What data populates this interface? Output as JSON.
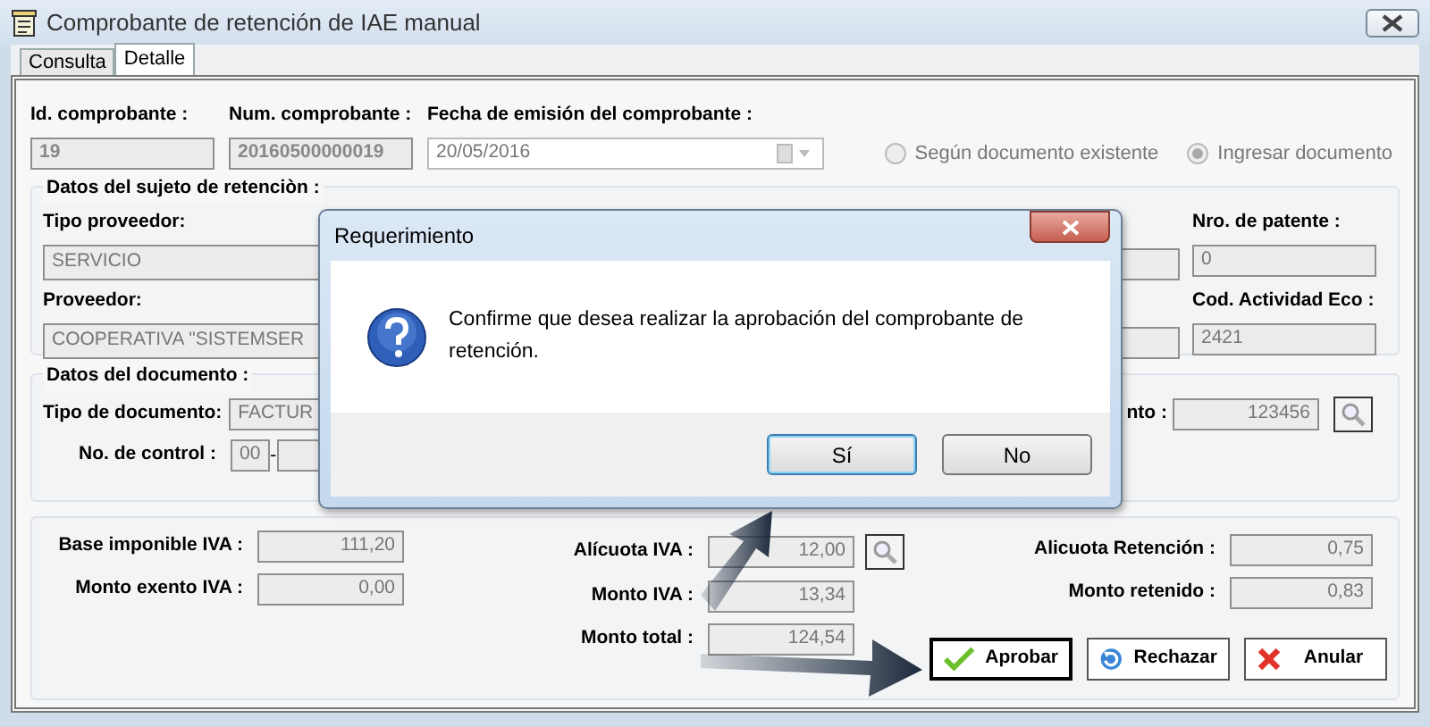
{
  "window": {
    "title": "Comprobante de retención de IAE manual"
  },
  "tabs": [
    {
      "label": "Consulta",
      "selected": false
    },
    {
      "label": "Detalle",
      "selected": true
    }
  ],
  "header_fields": [
    {
      "label": "Id. comprobante :",
      "value": "19"
    },
    {
      "label": "Num. comprobante :",
      "value": "20160500000019"
    },
    {
      "label": "Fecha de emisión del comprobante :",
      "value": "20/05/2016"
    }
  ],
  "source_options": [
    {
      "label": "Según documento existente",
      "selected": false
    },
    {
      "label": "Ingresar documento",
      "selected": true
    }
  ],
  "subject_group": {
    "title": "Datos del sujeto de retenciòn :",
    "left_fields": [
      {
        "label": "Tipo proveedor:",
        "value": "SERVICIO"
      },
      {
        "label": "Proveedor:",
        "value": "COOPERATIVA \"SISTEMSER"
      }
    ],
    "right_fields": [
      {
        "label": "Nro. de patente :",
        "value": "0"
      },
      {
        "label": "Cod. Actividad Eco :",
        "value": "2421"
      }
    ]
  },
  "document_group": {
    "title": "Datos del documento :",
    "type_field": {
      "label": "Tipo de documento:",
      "value": "FACTUR"
    },
    "control_field": {
      "label": "No. de control :",
      "prefix": "00",
      "separator": "-"
    },
    "number_field": {
      "label": "nto :",
      "value": "123456"
    }
  },
  "amounts": {
    "left": [
      {
        "label": "Base imponible IVA :",
        "value": "111,20"
      },
      {
        "label": "Monto exento IVA :",
        "value": "0,00"
      }
    ],
    "middle": [
      {
        "label": "Alícuota IVA :",
        "value": "12,00",
        "lookup": true
      },
      {
        "label": "Monto IVA :",
        "value": "13,34",
        "lookup": false
      },
      {
        "label": "Monto total :",
        "value": "124,54",
        "lookup": false
      }
    ],
    "right": [
      {
        "label": "Alicuota Retención :",
        "value": "0,75"
      },
      {
        "label": "Monto retenido :",
        "value": "0,83"
      }
    ]
  },
  "actions": [
    {
      "label": "Aprobar",
      "kind": "approve",
      "focused": true
    },
    {
      "label": "Rechazar",
      "kind": "reject",
      "focused": false
    },
    {
      "label": "Anular",
      "kind": "cancel",
      "focused": false
    }
  ],
  "dialog": {
    "title": "Requerimiento",
    "message": "Confirme que desea realizar la aprobación del comprobante de retención.",
    "buttons": [
      {
        "label": "Sí",
        "default": true
      },
      {
        "label": "No",
        "default": false
      }
    ]
  }
}
